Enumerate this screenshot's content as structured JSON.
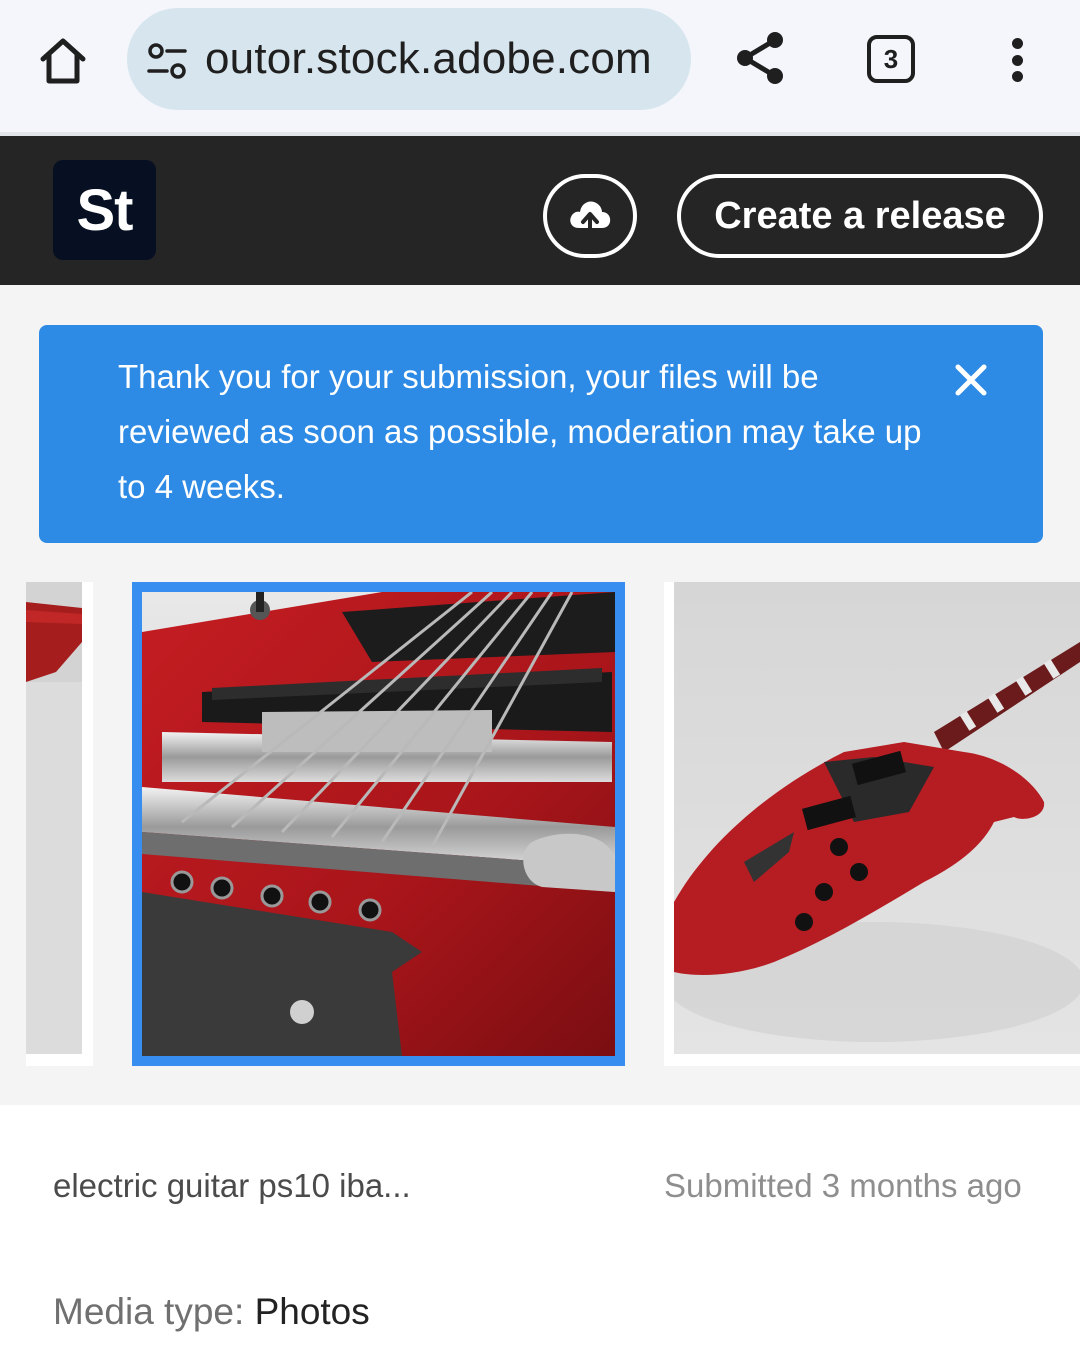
{
  "browser": {
    "url": "outor.stock.adobe.com",
    "tab_count": "3",
    "icons": [
      "home-icon",
      "site-info-icon",
      "share-icon",
      "more-vert-icon"
    ]
  },
  "app_header": {
    "logo_text": "St",
    "upload_icon": "cloud-upload-icon",
    "create_release_label": "Create a release"
  },
  "toast": {
    "message": "Thank you for your submission, your files will be reviewed as soon as possible, moderation may take up to 4 weeks.",
    "close_icon": "close-icon",
    "color": "#2e8be5"
  },
  "carousel": {
    "selected_index": 1,
    "selected_border_color": "#378ef0"
  },
  "details": {
    "file_name": "electric guitar ps10 iba...",
    "submitted": "Submitted 3 months ago",
    "media_type_label": "Media type: ",
    "media_type_value": "Photos"
  }
}
